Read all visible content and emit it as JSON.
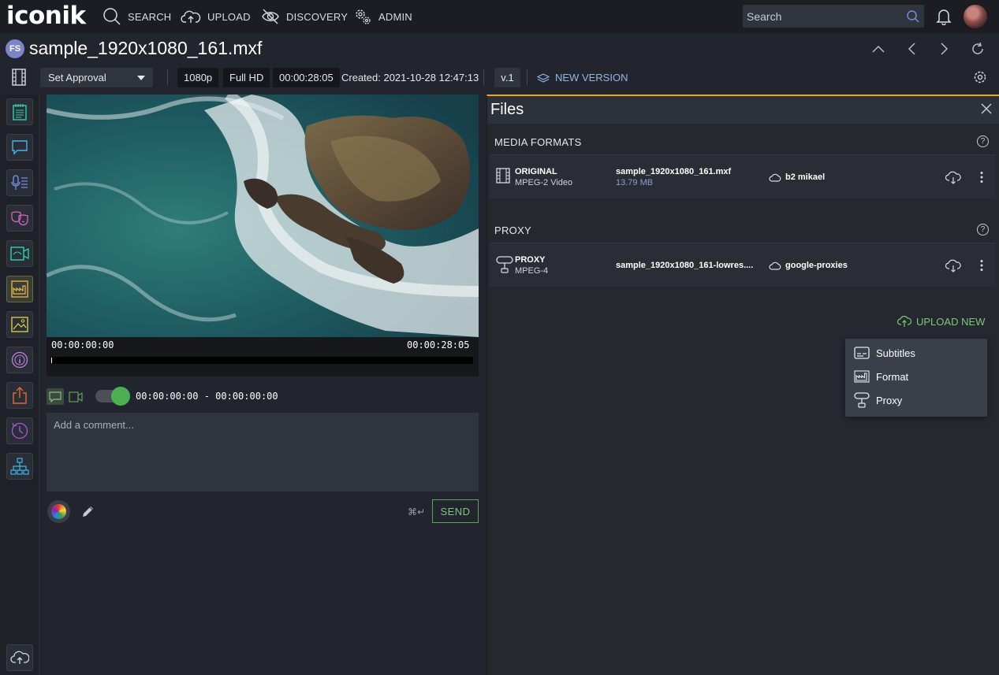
{
  "nav": {
    "logo": "iconik",
    "search_label": "SEARCH",
    "upload_label": "UPLOAD",
    "discovery_label": "DISCOVERY",
    "admin_label": "ADMIN",
    "search_placeholder": "Search"
  },
  "asset": {
    "initials": "FS",
    "title": "sample_1920x1080_161.mxf"
  },
  "toolbar": {
    "approval": "Set Approval",
    "resolution": "1080p",
    "quality": "Full HD",
    "duration": "00:00:28:05",
    "created": "Created: 2021-10-28 12:47:13",
    "version": "v.1",
    "new_version": "NEW VERSION"
  },
  "player": {
    "tc_start": "00:00:00:00",
    "tc_end": "00:00:28:05",
    "range": "00:00:00:00 - 00:00:00:00",
    "playhead_fraction": 0
  },
  "comment": {
    "placeholder": "Add a comment...",
    "shortcut": "⌘↵",
    "send": "SEND"
  },
  "files": {
    "title": "Files",
    "media_formats_label": "MEDIA FORMATS",
    "proxy_label": "PROXY",
    "help": "?",
    "rows": [
      {
        "kind": "ORIGINAL",
        "codec": "MPEG-2 Video",
        "filename": "sample_1920x1080_161.mxf",
        "size": "13.79 MB",
        "storage": "b2 mikael"
      },
      {
        "kind": "PROXY",
        "codec": "MPEG-4",
        "filename": "sample_1920x1080_161-lowres....",
        "size": "",
        "storage": "google-proxies"
      }
    ],
    "upload_new": "UPLOAD NEW",
    "menu": [
      "Subtitles",
      "Format",
      "Proxy"
    ]
  },
  "colors": {
    "accent_orange": "#f0a623",
    "accent_green": "#7cc77e",
    "link_blue": "#8fb7e6"
  }
}
